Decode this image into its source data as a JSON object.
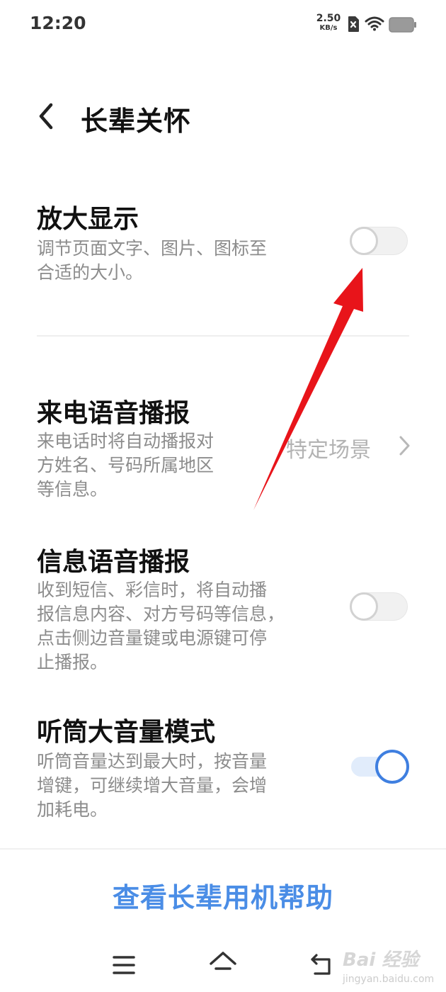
{
  "status_bar": {
    "time": "12:20",
    "net_speed_value": "2.50",
    "net_speed_unit": "KB/s",
    "icons": [
      "sim-x-icon",
      "wifi-icon",
      "battery-icon"
    ]
  },
  "header": {
    "title": "长辈关怀"
  },
  "settings": [
    {
      "title": "放大显示",
      "desc": [
        "调节页面文字、图片、图标至",
        "合适的大小。"
      ],
      "control": "toggle",
      "enabled": false
    },
    {
      "title": "来电语音播报",
      "desc": [
        "来电话时将自动播报对",
        "方姓名、号码所属地区",
        "等信息。"
      ],
      "control": "value",
      "value": "特定场景"
    },
    {
      "title": "信息语音播报",
      "desc": [
        "收到短信、彩信时，将自动播",
        "报信息内容、对方号码等信息，",
        "点击侧边音量键或电源键可停",
        "止播报。"
      ],
      "control": "toggle",
      "enabled": false
    },
    {
      "title": "听筒大音量模式",
      "desc": [
        "听筒音量达到最大时，按音量",
        "增键，可继续增大音量，会增",
        "加耗电。"
      ],
      "control": "toggle",
      "enabled": true
    }
  ],
  "footer": {
    "help_link": "查看长辈用机帮助"
  },
  "nav_bar": {
    "icons": [
      "menu-icon",
      "home-icon",
      "back-icon"
    ]
  },
  "watermark": {
    "logo_text": "Bai 经验",
    "url": "jingyan.baidu.com"
  },
  "colors": {
    "accent": "#4a8de6",
    "toggle_on": "#3f7fe0",
    "annotation_arrow": "#e8141a"
  }
}
